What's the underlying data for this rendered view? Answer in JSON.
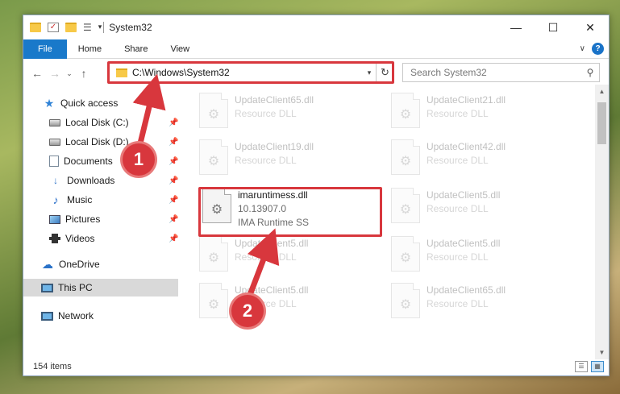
{
  "window": {
    "title": "System32"
  },
  "ribbon": {
    "tabs": [
      "File",
      "Home",
      "Share",
      "View"
    ],
    "help": "?"
  },
  "navigation": {
    "back": "←",
    "forward": "→",
    "recent": "⌄",
    "up": "↑"
  },
  "address": {
    "path": "C:\\Windows\\System32"
  },
  "search": {
    "placeholder": "Search System32"
  },
  "sidebar": {
    "quick_access": "Quick access",
    "items": [
      {
        "label": "Local Disk (C:)"
      },
      {
        "label": "Local Disk (D:)"
      },
      {
        "label": "Documents"
      },
      {
        "label": "Downloads"
      },
      {
        "label": "Music"
      },
      {
        "label": "Pictures"
      },
      {
        "label": "Videos"
      }
    ],
    "onedrive": "OneDrive",
    "thispc": "This PC",
    "network": "Network"
  },
  "files": [
    {
      "name": "UpdateClient65.dll",
      "desc": "Resource DLL"
    },
    {
      "name": "UpdateClient21.dll",
      "desc": "Resource DLL"
    },
    {
      "name": "UpdateClient19.dll",
      "desc": "Resource DLL"
    },
    {
      "name": "UpdateClient42.dll",
      "desc": "Resource DLL"
    },
    {
      "name": "imaruntimess.dll",
      "version": "10.13907.0",
      "desc": "IMA Runtime SS"
    },
    {
      "name": "UpdateClient5.dll",
      "desc": "Resource DLL"
    },
    {
      "name": "UpdateClient5.dll",
      "desc": "Resource DLL"
    },
    {
      "name": "UpdateClient5.dll",
      "desc": "Resource DLL"
    },
    {
      "name": "UpdateClient5.dll",
      "desc": "Resource DLL"
    },
    {
      "name": "UpdateClient65.dll",
      "desc": "Resource DLL"
    }
  ],
  "status": {
    "item_count": "154 items"
  },
  "callouts": [
    "1",
    "2"
  ],
  "colors": {
    "accent": "#1979ca",
    "highlight": "#d8373d"
  }
}
